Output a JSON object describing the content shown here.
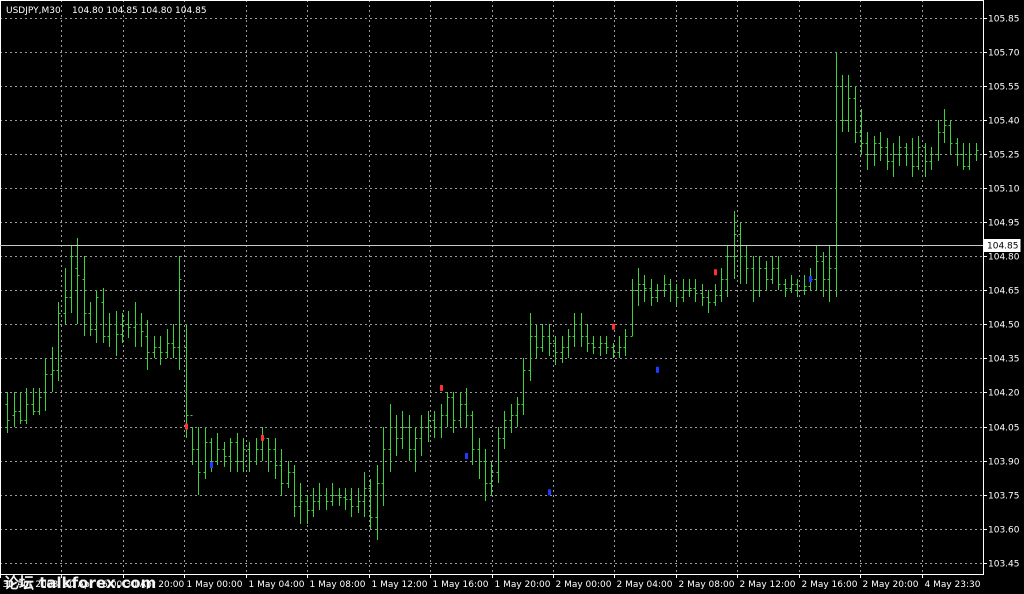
{
  "header": {
    "symbol": "USDJPY,M30",
    "ohlc": "104.80 104.85 104.80 104.85"
  },
  "current_price": "104.85",
  "watermark": "论坛 talkforex.com",
  "colors": {
    "background": "#000000",
    "bar": "#3cd23c",
    "grid": "#9a9a9a",
    "sell_mark": "#ff3030",
    "buy_mark": "#1e3cff"
  },
  "chart_data": {
    "type": "bar",
    "style": "ohlc",
    "ylim": [
      103.4,
      105.93
    ],
    "y_ticks": [
      "105.85",
      "105.70",
      "105.55",
      "105.40",
      "105.25",
      "105.10",
      "104.95",
      "104.80",
      "104.65",
      "104.50",
      "104.35",
      "104.20",
      "104.05",
      "103.90",
      "103.75",
      "103.60",
      "103.45"
    ],
    "x_ticks": [
      "30 Apr 2008",
      "30 Apr 16:00",
      "30 Apr 20:00",
      "1 May 00:00",
      "1 May 04:00",
      "1 May 08:00",
      "1 May 12:00",
      "1 May 16:00",
      "1 May 20:00",
      "2 May 00:00",
      "2 May 04:00",
      "2 May 08:00",
      "2 May 12:00",
      "2 May 16:00",
      "2 May 20:00",
      "4 May 23:30"
    ],
    "grid": true,
    "bars": [
      [
        104.15,
        104.08,
        104.2,
        104.02
      ],
      [
        104.1,
        104.12,
        104.2,
        104.05
      ],
      [
        104.12,
        104.08,
        104.2,
        104.06
      ],
      [
        104.08,
        104.15,
        104.22,
        104.06
      ],
      [
        104.15,
        104.12,
        104.22,
        104.1
      ],
      [
        104.12,
        104.18,
        104.22,
        104.1
      ],
      [
        104.2,
        104.28,
        104.35,
        104.12
      ],
      [
        104.28,
        104.3,
        104.4,
        104.2
      ],
      [
        104.3,
        104.55,
        104.6,
        104.25
      ],
      [
        104.55,
        104.62,
        104.75,
        104.5
      ],
      [
        104.62,
        104.8,
        104.85,
        104.55
      ],
      [
        104.75,
        104.72,
        104.88,
        104.5
      ],
      [
        104.7,
        104.55,
        104.8,
        104.45
      ],
      [
        104.55,
        104.48,
        104.6,
        104.45
      ],
      [
        104.48,
        104.62,
        104.65,
        104.42
      ],
      [
        104.6,
        104.45,
        104.66,
        104.42
      ],
      [
        104.45,
        104.5,
        104.55,
        104.4
      ],
      [
        104.5,
        104.46,
        104.56,
        104.36
      ],
      [
        104.46,
        104.52,
        104.55,
        104.42
      ],
      [
        104.5,
        104.49,
        104.56,
        104.44
      ],
      [
        104.49,
        104.5,
        104.6,
        104.4
      ],
      [
        104.5,
        104.47,
        104.55,
        104.4
      ],
      [
        104.45,
        104.38,
        104.52,
        104.3
      ],
      [
        104.38,
        104.4,
        104.45,
        104.35
      ],
      [
        104.4,
        104.38,
        104.45,
        104.32
      ],
      [
        104.38,
        104.42,
        104.48,
        104.35
      ],
      [
        104.42,
        104.4,
        104.5,
        104.35
      ],
      [
        104.4,
        104.7,
        104.8,
        104.3
      ],
      [
        104.4,
        104.1,
        104.5,
        104.0
      ],
      [
        104.1,
        103.95,
        104.05,
        103.88
      ],
      [
        103.95,
        103.85,
        104.05,
        103.75
      ],
      [
        103.85,
        103.98,
        104.05,
        103.82
      ],
      [
        103.98,
        103.9,
        104.0,
        103.85
      ],
      [
        103.9,
        103.95,
        104.02,
        103.88
      ],
      [
        103.95,
        103.92,
        103.98,
        103.87
      ],
      [
        103.92,
        103.98,
        104.0,
        103.85
      ],
      [
        103.98,
        103.9,
        104.02,
        103.85
      ],
      [
        103.9,
        103.95,
        104.0,
        103.85
      ],
      [
        103.95,
        103.9,
        103.98,
        103.85
      ],
      [
        103.9,
        103.95,
        104.0,
        103.88
      ],
      [
        103.95,
        104.0,
        104.05,
        103.9
      ],
      [
        104.0,
        103.95,
        104.0,
        103.85
      ],
      [
        103.95,
        103.88,
        104.0,
        103.82
      ],
      [
        103.88,
        103.8,
        103.95,
        103.75
      ],
      [
        103.8,
        103.85,
        103.9,
        103.78
      ],
      [
        103.85,
        103.7,
        103.88,
        103.65
      ],
      [
        103.7,
        103.72,
        103.8,
        103.62
      ],
      [
        103.72,
        103.68,
        103.75,
        103.62
      ],
      [
        103.68,
        103.72,
        103.78,
        103.65
      ],
      [
        103.72,
        103.75,
        103.8,
        103.68
      ],
      [
        103.75,
        103.72,
        103.78,
        103.68
      ],
      [
        103.72,
        103.75,
        103.8,
        103.7
      ],
      [
        103.75,
        103.74,
        103.78,
        103.7
      ],
      [
        103.74,
        103.73,
        103.78,
        103.68
      ],
      [
        103.73,
        103.7,
        103.78,
        103.65
      ],
      [
        103.7,
        103.72,
        103.78,
        103.67
      ],
      [
        103.72,
        103.78,
        103.85,
        103.65
      ],
      [
        103.78,
        103.65,
        103.82,
        103.6
      ],
      [
        103.65,
        103.8,
        103.88,
        103.55
      ],
      [
        103.8,
        103.95,
        104.05,
        103.7
      ],
      [
        103.95,
        104.05,
        104.15,
        103.85
      ],
      [
        104.05,
        104.0,
        104.1,
        103.92
      ],
      [
        104.0,
        104.05,
        104.12,
        103.95
      ],
      [
        104.05,
        103.95,
        104.1,
        103.9
      ],
      [
        103.95,
        104.0,
        104.05,
        103.85
      ],
      [
        104.0,
        104.05,
        104.1,
        103.92
      ],
      [
        104.05,
        104.08,
        104.12,
        103.98
      ],
      [
        104.08,
        104.05,
        104.12,
        104.0
      ],
      [
        104.05,
        104.1,
        104.15,
        104.0
      ],
      [
        104.1,
        104.18,
        104.2,
        104.05
      ],
      [
        104.18,
        104.08,
        104.2,
        104.02
      ],
      [
        104.08,
        104.15,
        104.2,
        104.05
      ],
      [
        104.15,
        104.1,
        104.22,
        104.05
      ],
      [
        104.1,
        103.95,
        104.12,
        103.88
      ],
      [
        103.95,
        103.9,
        104.0,
        103.82
      ],
      [
        103.9,
        103.8,
        103.95,
        103.72
      ],
      [
        103.8,
        103.85,
        103.9,
        103.75
      ],
      [
        103.85,
        104.0,
        104.05,
        103.8
      ],
      [
        104.0,
        104.08,
        104.12,
        103.95
      ],
      [
        104.08,
        104.1,
        104.15,
        104.02
      ],
      [
        104.1,
        104.15,
        104.18,
        104.05
      ],
      [
        104.15,
        104.3,
        104.35,
        104.1
      ],
      [
        104.3,
        104.45,
        104.55,
        104.25
      ],
      [
        104.45,
        104.4,
        104.5,
        104.35
      ],
      [
        104.4,
        104.45,
        104.5,
        104.38
      ],
      [
        104.45,
        104.42,
        104.5,
        104.36
      ],
      [
        104.42,
        104.38,
        104.45,
        104.32
      ],
      [
        104.38,
        104.4,
        104.45,
        104.33
      ],
      [
        104.4,
        104.45,
        104.48,
        104.35
      ],
      [
        104.45,
        104.5,
        104.55,
        104.4
      ],
      [
        104.5,
        104.45,
        104.55,
        104.4
      ],
      [
        104.45,
        104.42,
        104.5,
        104.38
      ],
      [
        104.42,
        104.4,
        104.45,
        104.37
      ],
      [
        104.4,
        104.42,
        104.45,
        104.36
      ],
      [
        104.42,
        104.4,
        104.45,
        104.37
      ],
      [
        104.4,
        104.38,
        104.42,
        104.35
      ],
      [
        104.38,
        104.4,
        104.45,
        104.35
      ],
      [
        104.4,
        104.45,
        104.48,
        104.36
      ],
      [
        104.45,
        104.65,
        104.7,
        104.45
      ],
      [
        104.65,
        104.68,
        104.75,
        104.58
      ],
      [
        104.68,
        104.66,
        104.72,
        104.6
      ],
      [
        104.66,
        104.62,
        104.7,
        104.58
      ],
      [
        104.62,
        104.65,
        104.68,
        104.6
      ],
      [
        104.65,
        104.68,
        104.72,
        104.62
      ],
      [
        104.68,
        104.65,
        104.7,
        104.6
      ],
      [
        104.65,
        104.62,
        104.68,
        104.58
      ],
      [
        104.62,
        104.65,
        104.7,
        104.6
      ],
      [
        104.65,
        104.66,
        104.7,
        104.62
      ],
      [
        104.66,
        104.64,
        104.7,
        104.6
      ],
      [
        104.64,
        104.62,
        104.68,
        104.58
      ],
      [
        104.62,
        104.6,
        104.65,
        104.55
      ],
      [
        104.6,
        104.63,
        104.68,
        104.58
      ],
      [
        104.63,
        104.7,
        104.75,
        104.6
      ],
      [
        104.7,
        104.8,
        104.85,
        104.62
      ],
      [
        104.8,
        104.9,
        105.0,
        104.7
      ],
      [
        104.9,
        104.8,
        104.95,
        104.68
      ],
      [
        104.8,
        104.75,
        104.85,
        104.68
      ],
      [
        104.75,
        104.65,
        104.8,
        104.6
      ],
      [
        104.65,
        104.75,
        104.8,
        104.62
      ],
      [
        104.75,
        104.7,
        104.78,
        104.65
      ],
      [
        104.7,
        104.75,
        104.8,
        104.68
      ],
      [
        104.75,
        104.68,
        104.8,
        104.65
      ],
      [
        104.68,
        104.66,
        104.7,
        104.62
      ],
      [
        104.66,
        104.68,
        104.72,
        104.64
      ],
      [
        104.68,
        104.65,
        104.7,
        104.62
      ],
      [
        104.65,
        104.67,
        104.72,
        104.63
      ],
      [
        104.67,
        104.7,
        104.75,
        104.65
      ],
      [
        104.7,
        104.78,
        104.85,
        104.65
      ],
      [
        104.78,
        104.7,
        104.82,
        104.62
      ],
      [
        104.7,
        104.75,
        104.85,
        104.6
      ],
      [
        104.75,
        105.55,
        105.7,
        104.62
      ],
      [
        105.55,
        105.4,
        105.6,
        105.35
      ],
      [
        105.4,
        105.5,
        105.6,
        105.35
      ],
      [
        105.5,
        105.35,
        105.55,
        105.3
      ],
      [
        105.35,
        105.3,
        105.45,
        105.25
      ],
      [
        105.3,
        105.25,
        105.35,
        105.18
      ],
      [
        105.25,
        105.3,
        105.33,
        105.2
      ],
      [
        105.3,
        105.28,
        105.35,
        105.22
      ],
      [
        105.28,
        105.22,
        105.32,
        105.18
      ],
      [
        105.22,
        105.25,
        105.3,
        105.15
      ],
      [
        105.25,
        105.28,
        105.33,
        105.2
      ],
      [
        105.28,
        105.25,
        105.3,
        105.2
      ],
      [
        105.25,
        105.2,
        105.32,
        105.15
      ],
      [
        105.2,
        105.28,
        105.33,
        105.18
      ],
      [
        105.28,
        105.22,
        105.3,
        105.15
      ],
      [
        105.22,
        105.25,
        105.28,
        105.18
      ],
      [
        105.25,
        105.35,
        105.4,
        105.22
      ],
      [
        105.35,
        105.38,
        105.45,
        105.3
      ],
      [
        105.38,
        105.3,
        105.4,
        105.25
      ],
      [
        105.3,
        105.25,
        105.32,
        105.2
      ],
      [
        105.25,
        105.2,
        105.3,
        105.18
      ],
      [
        105.2,
        105.25,
        105.3,
        105.18
      ],
      [
        105.25,
        105.27,
        105.3,
        105.22
      ]
    ],
    "signal_marks": [
      {
        "bar": 28,
        "price": 104.05,
        "kind": "sell"
      },
      {
        "bar": 32,
        "price": 103.88,
        "kind": "buy"
      },
      {
        "bar": 40,
        "price": 104.0,
        "kind": "sell"
      },
      {
        "bar": 68,
        "price": 104.22,
        "kind": "sell"
      },
      {
        "bar": 72,
        "price": 103.92,
        "kind": "buy"
      },
      {
        "bar": 85,
        "price": 103.76,
        "kind": "buy"
      },
      {
        "bar": 95,
        "price": 104.49,
        "kind": "sell"
      },
      {
        "bar": 102,
        "price": 104.3,
        "kind": "buy"
      },
      {
        "bar": 111,
        "price": 104.73,
        "kind": "sell"
      },
      {
        "bar": 126,
        "price": 104.7,
        "kind": "buy"
      }
    ]
  }
}
